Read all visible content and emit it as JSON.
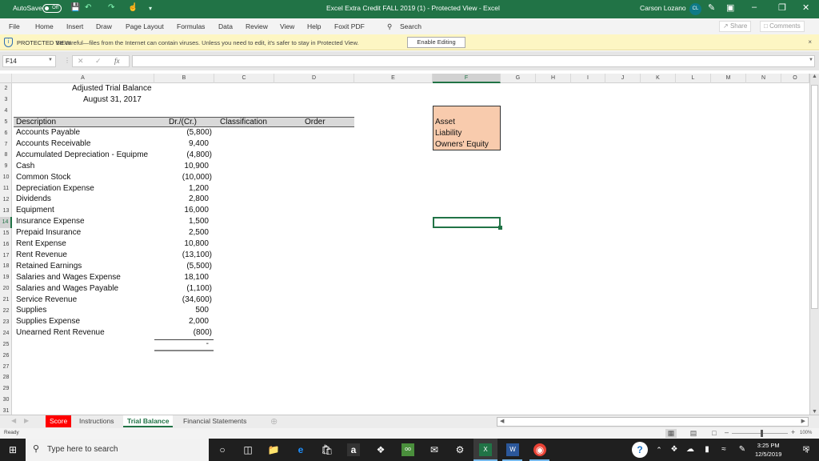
{
  "titlebar": {
    "autosave_label": "AutoSave",
    "autosave_state": "Off",
    "title": "Excel Extra Credit FALL 2019 (1)  -  Protected View  -  Excel",
    "user_name": "Carson Lozano",
    "user_initials": "CL"
  },
  "menu": {
    "items": [
      "File",
      "Home",
      "Insert",
      "Draw",
      "Page Layout",
      "Formulas",
      "Data",
      "Review",
      "View",
      "Help",
      "Foxit PDF"
    ],
    "search_label": "Search",
    "share_label": "Share",
    "comments_label": "Comments"
  },
  "protected_view": {
    "title": "PROTECTED VIEW",
    "message": "Be careful—files from the Internet can contain viruses. Unless you need to edit, it's safer to stay in Protected View.",
    "enable_button": "Enable Editing",
    "close": "×"
  },
  "formula_bar": {
    "name_box": "F14",
    "formula_value": "",
    "fx_label": "fx"
  },
  "grid": {
    "columns": [
      "A",
      "B",
      "C",
      "D",
      "E",
      "F",
      "G",
      "H",
      "I",
      "J",
      "K",
      "L",
      "M",
      "N",
      "O"
    ],
    "selected_column": "F",
    "selected_row": "14",
    "rows": [
      "2",
      "3",
      "4",
      "5",
      "6",
      "7",
      "8",
      "9",
      "10",
      "11",
      "12",
      "13",
      "14",
      "15",
      "16",
      "17",
      "18",
      "19",
      "20",
      "21",
      "22",
      "23",
      "24",
      "25",
      "26",
      "27",
      "28",
      "29",
      "30",
      "31"
    ],
    "title": "Adjusted Trial Balance",
    "date": "August 31, 2017",
    "headers": {
      "description": "Description",
      "amount": "Dr./(Cr.)",
      "classification": "Classification",
      "order": "Order"
    },
    "accounts": [
      {
        "description": "Accounts Payable",
        "amount": "(5,800)"
      },
      {
        "description": "Accounts Receivable",
        "amount": "9,400"
      },
      {
        "description": "Accumulated Depreciation - Equipme",
        "amount": "(4,800)"
      },
      {
        "description": "Cash",
        "amount": "10,900"
      },
      {
        "description": "Common Stock",
        "amount": "(10,000)"
      },
      {
        "description": "Depreciation Expense",
        "amount": "1,200"
      },
      {
        "description": "Dividends",
        "amount": "2,800"
      },
      {
        "description": "Equipment",
        "amount": "16,000"
      },
      {
        "description": "Insurance Expense",
        "amount": "1,500"
      },
      {
        "description": "Prepaid Insurance",
        "amount": "2,500"
      },
      {
        "description": "Rent Expense",
        "amount": "10,800"
      },
      {
        "description": "Rent Revenue",
        "amount": "(13,100)"
      },
      {
        "description": "Retained Earnings",
        "amount": "(5,500)"
      },
      {
        "description": "Salaries and Wages Expense",
        "amount": "18,100"
      },
      {
        "description": "Salaries and Wages Payable",
        "amount": "(1,100)"
      },
      {
        "description": "Service Revenue",
        "amount": "(34,600)"
      },
      {
        "description": "Supplies",
        "amount": "500"
      },
      {
        "description": "Supplies Expense",
        "amount": "2,000"
      },
      {
        "description": "Unearned Rent Revenue",
        "amount": "(800)"
      }
    ],
    "total": "-",
    "classification_legend": [
      "Asset",
      "Liability",
      "Owners' Equity"
    ]
  },
  "sheet_tabs": [
    {
      "label": "Score",
      "state": "score"
    },
    {
      "label": "Instructions",
      "state": "normal"
    },
    {
      "label": "Trial Balance",
      "state": "active"
    },
    {
      "label": "Financial Statements",
      "state": "normal"
    }
  ],
  "statusbar": {
    "ready": "Ready",
    "zoom": "100%"
  },
  "taskbar": {
    "search_placeholder": "Type here to search",
    "time": "3:25 PM",
    "date": "12/5/2019",
    "notification_count": "4"
  }
}
